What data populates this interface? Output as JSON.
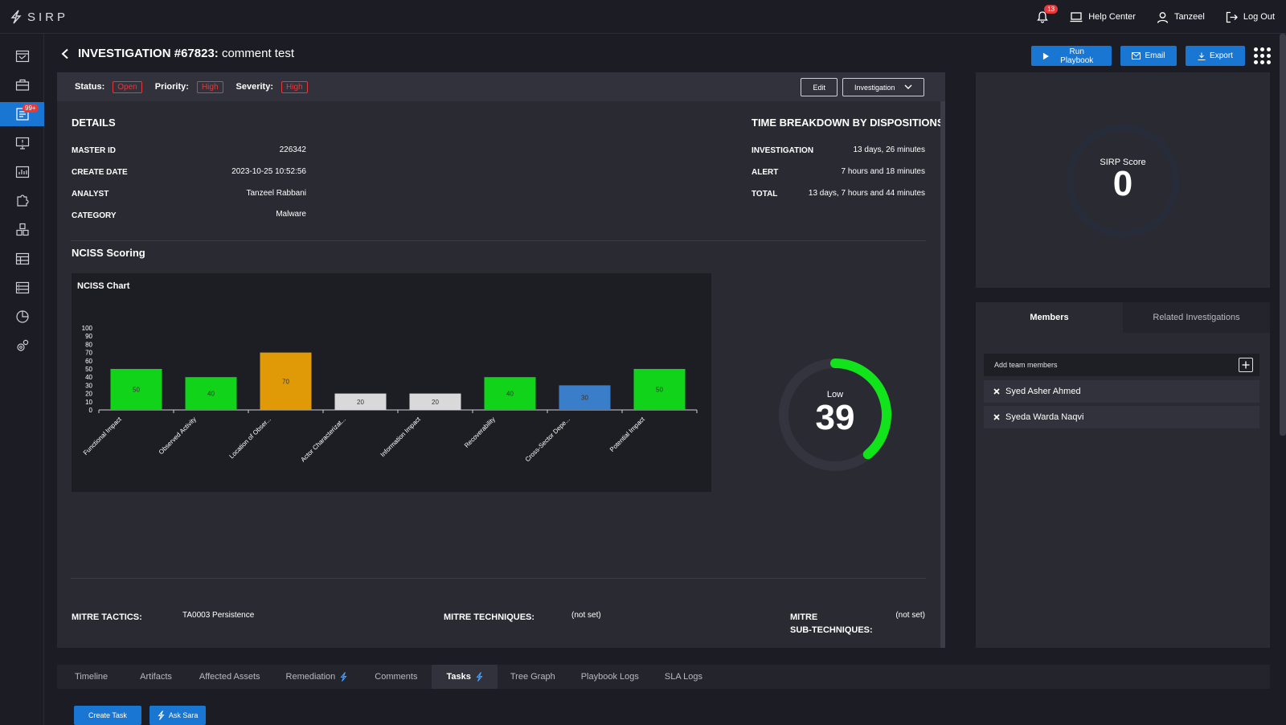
{
  "app": {
    "logo_text": "SIRP"
  },
  "topbar": {
    "notifications_count": "13",
    "help_center": "Help Center",
    "user": "Tanzeel",
    "logout": "Log Out"
  },
  "sidebar": {
    "badge": "99+"
  },
  "header": {
    "title_strong": "INVESTIGATION #67823:",
    "title_rest": "comment test",
    "run_playbook": "Run Playbook",
    "email": "Email",
    "export": "Export"
  },
  "status": {
    "status_label": "Status:",
    "status_value": "Open",
    "priority_label": "Priority:",
    "priority_value": "High",
    "severity_label": "Severity:",
    "severity_value": "High",
    "edit": "Edit",
    "dropdown": "Investigation"
  },
  "details": {
    "title": "DETAILS",
    "rows": [
      {
        "label": "MASTER ID",
        "value": "226342"
      },
      {
        "label": "CREATE DATE",
        "value": "2023-10-25 10:52:56"
      },
      {
        "label": "ANALYST",
        "value": "Tanzeel Rabbani"
      },
      {
        "label": "CATEGORY",
        "value": "Malware"
      }
    ]
  },
  "time_breakdown": {
    "title": "TIME BREAKDOWN BY DISPOSITIONS",
    "rows": [
      {
        "label": "INVESTIGATION",
        "value": "13 days, 26 minutes"
      },
      {
        "label": "ALERT",
        "value": "7 hours and 18 minutes"
      },
      {
        "label": "TOTAL",
        "value": "13 days, 7 hours and 44 minutes"
      }
    ]
  },
  "nciss": {
    "title": "NCISS Scoring",
    "gauge_label": "Low",
    "gauge_value": "39",
    "gauge_fraction": 0.39
  },
  "chart_data": {
    "type": "bar",
    "title": "NCISS Chart",
    "categories": [
      "Functional Impact",
      "Observed Activity",
      "Location of Obser...",
      "Actor Characterizat...",
      "Information Impact",
      "Recoverability",
      "Cross-Sector Depe...",
      "Potential Impact"
    ],
    "values": [
      50,
      40,
      70,
      20,
      20,
      40,
      30,
      50
    ],
    "colors": [
      "#11d41a",
      "#11d41a",
      "#e19a07",
      "#d9d9d9",
      "#d9d9d9",
      "#11d41a",
      "#3a7dc8",
      "#11d41a"
    ],
    "yticks": [
      "0",
      "10",
      "20",
      "30",
      "40",
      "50",
      "60",
      "70",
      "80",
      "90",
      "100"
    ],
    "ylim": [
      0,
      100
    ],
    "xlabel": "",
    "ylabel": "",
    "grid": false
  },
  "mitre": {
    "tactics_label": "MITRE TACTICS:",
    "tactics_value": "TA0003 Persistence",
    "techniques_label": "MITRE TECHNIQUES:",
    "techniques_value": "(not set)",
    "sub_label_1": "MITRE",
    "sub_label_2": "SUB-TECHNIQUES:",
    "sub_value": "(not set)"
  },
  "score": {
    "label": "SIRP Score",
    "value": "0"
  },
  "members": {
    "tab_members": "Members",
    "tab_related": "Related Investigations",
    "add_placeholder": "Add team members",
    "list": [
      "Syed Asher Ahmed",
      "Syeda Warda Naqvi"
    ]
  },
  "bottom_tabs": [
    "Timeline",
    "Artifacts",
    "Affected Assets",
    "Remediation",
    "Comments",
    "Tasks",
    "Tree Graph",
    "Playbook Logs",
    "SLA Logs"
  ],
  "bottom_actions": {
    "create_task": "Create Task",
    "ask_sara": "Ask Sara"
  }
}
